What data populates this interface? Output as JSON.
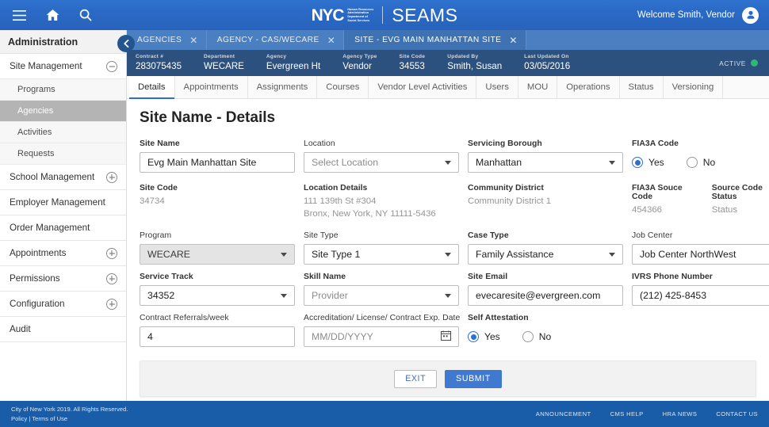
{
  "header": {
    "icons": [
      "hamburger-menu-icon",
      "home-icon",
      "search-icon"
    ],
    "logo_word": "NYC",
    "logo_sub_lines": [
      "Human Resources",
      "Administration",
      "Department of",
      "Social Services"
    ],
    "app_name": "SEAMS",
    "welcome_text": "Welcome Smith, Vendor"
  },
  "sidebar": {
    "title": "Administration",
    "items": [
      {
        "label": "Site Management",
        "toggle": "minus",
        "expanded": true
      },
      {
        "label": "School Management",
        "toggle": "plus",
        "expanded": false
      },
      {
        "label": "Employer Management",
        "toggle": "none",
        "expanded": false
      },
      {
        "label": "Order Management",
        "toggle": "none",
        "expanded": false
      },
      {
        "label": "Appointments",
        "toggle": "plus",
        "expanded": false
      },
      {
        "label": "Permissions",
        "toggle": "plus",
        "expanded": false
      },
      {
        "label": "Configuration",
        "toggle": "plus",
        "expanded": false
      },
      {
        "label": "Audit",
        "toggle": "none",
        "expanded": false
      }
    ],
    "sub_items": [
      {
        "label": "Programs",
        "active": false
      },
      {
        "label": "Agencies",
        "active": true
      },
      {
        "label": "Activities",
        "active": false
      },
      {
        "label": "Requests",
        "active": false
      }
    ]
  },
  "window_tabs": [
    {
      "label": "AGENCIES",
      "active": false
    },
    {
      "label": "AGENCY - CAS/WECARE",
      "active": false
    },
    {
      "label": "SITE - EVG MAIN MANHATTAN SITE",
      "active": true
    }
  ],
  "meta": [
    {
      "key": "Contract #",
      "value": "283075435"
    },
    {
      "key": "Department",
      "value": "WECARE"
    },
    {
      "key": "Agency",
      "value": "Evergreen Ht"
    },
    {
      "key": "Agency Type",
      "value": "Vendor"
    },
    {
      "key": "Site Code",
      "value": "34553"
    },
    {
      "key": "Updated By",
      "value": "Smith, Susan"
    },
    {
      "key": "Last Updated On",
      "value": "03/05/2016"
    }
  ],
  "status": {
    "label": "ACTIVE",
    "color": "#2eb872"
  },
  "sub_tabs": [
    {
      "label": "Details",
      "active": true
    },
    {
      "label": "Appointments",
      "active": false
    },
    {
      "label": "Assignments",
      "active": false
    },
    {
      "label": "Courses",
      "active": false
    },
    {
      "label": "Vendor Level Activities",
      "active": false
    },
    {
      "label": "Users",
      "active": false
    },
    {
      "label": "MOU",
      "active": false
    },
    {
      "label": "Operations",
      "active": false
    },
    {
      "label": "Status",
      "active": false
    },
    {
      "label": "Versioning",
      "active": false
    }
  ],
  "form": {
    "page_title": "Site Name - Details",
    "site_name": {
      "label": "Site Name",
      "value": "Evg Main Manhattan Site"
    },
    "location": {
      "label": "Location",
      "value": "Select Location"
    },
    "servicing_borough": {
      "label": "Servicing Borough",
      "value": "Manhattan"
    },
    "fia3a_code": {
      "label": "FIA3A Code",
      "yes": "Yes",
      "no": "No",
      "selected": "Yes"
    },
    "site_code": {
      "label": "Site Code",
      "value": "34734"
    },
    "location_details": {
      "label": "Location Details",
      "line1": "111 139th St #304",
      "line2": "Bronx, New York, NY 11111-5436"
    },
    "community_district": {
      "label": "Community District",
      "value": "Community District 1"
    },
    "fia3a_source_code": {
      "label": "FIA3A Souce Code",
      "value": "454366"
    },
    "source_code_status": {
      "label": "Source Code Status",
      "value": "Status"
    },
    "program": {
      "label": "Program",
      "value": "WECARE"
    },
    "site_type": {
      "label": "Site Type",
      "value": "Site Type 1"
    },
    "case_type": {
      "label": "Case Type",
      "value": "Family Assistance"
    },
    "job_center": {
      "label": "Job Center",
      "value": "Job Center NorthWest"
    },
    "service_track": {
      "label": "Service Track",
      "value": "34352"
    },
    "skill_name": {
      "label": "Skill Name",
      "value": "Provider"
    },
    "site_email": {
      "label": "Site Email",
      "value": "evecaresite@evergreen.com"
    },
    "ivrs_phone": {
      "label": "IVRS Phone Number",
      "value": "(212) 425-8453"
    },
    "contract_referrals": {
      "label": "Contract Referrals/week",
      "value": "4"
    },
    "accreditation_date": {
      "label": "Accreditation/ License/ Contract Exp. Date",
      "placeholder": "MM/DD/YYYY",
      "value": ""
    },
    "self_attestation": {
      "label": "Self Attestation",
      "yes": "Yes",
      "no": "No",
      "selected": "Yes"
    },
    "exit_button": "EXIT",
    "submit_button": "SUBMIT"
  },
  "footer": {
    "copyright": "City of New York 2019. All Rights Reserved.",
    "policy": "Policy",
    "separator": "|",
    "terms": "Terms of Use",
    "links": [
      "ANNOUNCEMENT",
      "CMS HELP",
      "HRA NEWS",
      "CONTACT US"
    ]
  }
}
